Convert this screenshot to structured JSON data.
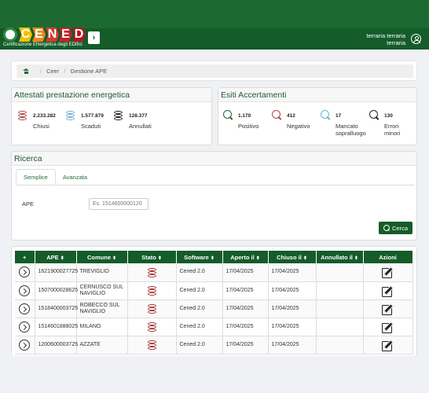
{
  "header": {
    "logo_letters": [
      "C",
      "E",
      "N",
      "E",
      "D"
    ],
    "logo_colors": [
      "#f2c100",
      "#e88a1a",
      "#d23c2b",
      "#c91f2a",
      "#b51425"
    ],
    "logo_subtitle": "Certificazione ENergetica degli EDifici",
    "menu_icon": "chevron-right-icon",
    "user_name": "terraria terraria",
    "user_role": "terraria",
    "user_icon": "user-circle-icon"
  },
  "breadcrumb": {
    "home_icon": "home-icon",
    "items": [
      "Ceer",
      "Gestione APE"
    ]
  },
  "attestati": {
    "title": "Attestati prestazione energetica",
    "stats": [
      {
        "value": "2.233.282",
        "label": "Chiusi",
        "color": "#b04646"
      },
      {
        "value": "1.577.879",
        "label": "Scaduti",
        "color": "#6cb4d8"
      },
      {
        "value": "128.377",
        "label": "Annullati",
        "color": "#222222"
      }
    ]
  },
  "esiti": {
    "title": "Esiti Accertamenti",
    "stats": [
      {
        "value": "1.170",
        "label": "Positivo",
        "color": "#1c6a32"
      },
      {
        "value": "412",
        "label": "Negativo",
        "color": "#b04646"
      },
      {
        "value": "17",
        "label": "Mancato sopralluogo",
        "color": "#6cb4d8"
      },
      {
        "value": "130",
        "label": "Errori minori",
        "color": "#222222"
      }
    ]
  },
  "ricerca": {
    "title": "Ricerca",
    "tabs": [
      "Semplice",
      "Avanzata"
    ],
    "field_label": "APE",
    "field_placeholder": "Es. 1514600000120",
    "search_button": "Cerca"
  },
  "table": {
    "headers": [
      "+",
      "APE",
      "Comune",
      "Stato",
      "Software",
      "Aperto il",
      "Chiuso il",
      "Annullato il",
      "Azioni"
    ],
    "rows": [
      {
        "ape": "1621900027725",
        "comune": "TREVIGLIO",
        "software": "Cened 2.0",
        "aperto": "17/04/2025",
        "chiuso": "17/04/2025",
        "annullato": ""
      },
      {
        "ape": "1507000028625",
        "comune": "CERNUSCO SUL NAVIGLIO",
        "software": "Cened 2.0",
        "aperto": "17/04/2025",
        "chiuso": "17/04/2025",
        "annullato": ""
      },
      {
        "ape": "1518400003725",
        "comune": "ROBECCO SUL NAVIGLIO",
        "software": "Cened 2.0",
        "aperto": "17/04/2025",
        "chiuso": "17/04/2025",
        "annullato": ""
      },
      {
        "ape": "1514601888025",
        "comune": "MILANO",
        "software": "Cened 2.0",
        "aperto": "17/04/2025",
        "chiuso": "17/04/2025",
        "annullato": ""
      },
      {
        "ape": "1200600003725",
        "comune": "AZZATE",
        "software": "Cened 2.0",
        "aperto": "17/04/2025",
        "chiuso": "17/04/2025",
        "annullato": ""
      }
    ]
  }
}
